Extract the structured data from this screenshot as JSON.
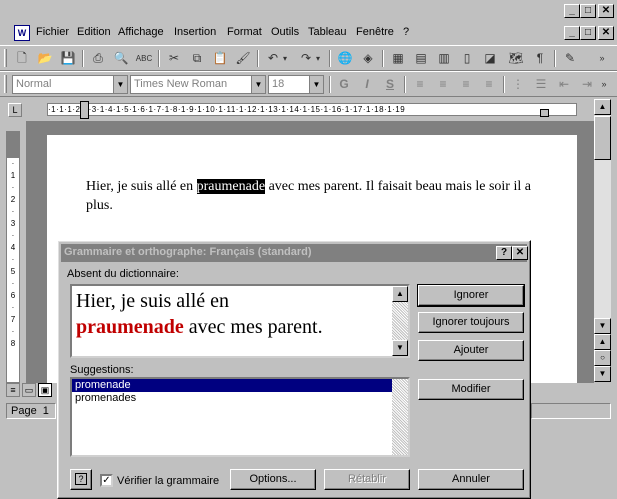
{
  "menubar": {
    "items": [
      "Fichier",
      "Edition",
      "Affichage",
      "Insertion",
      "Format",
      "Outils",
      "Tableau",
      "Fenêtre",
      "?"
    ]
  },
  "formatting": {
    "style": "Normal",
    "font": "Times New Roman",
    "size": "18",
    "bold": "G",
    "italic": "I",
    "underline": "S"
  },
  "ruler": {
    "marks": "·1·1·1·2·1·3·1·4·1·5·1·6·1·7·1·8·1·9·1·10·1·11·1·12·1·13·1·14·1·15·1·16·1·17·1·18·1·19"
  },
  "document": {
    "before": "Hier, je suis allé en ",
    "highlighted": "praumenade",
    "after": " avec mes parent. Il faisait beau mais le soir il a plus."
  },
  "statusbar": {
    "page": "Page  1"
  },
  "dialog": {
    "title": "Grammaire et orthographe: Français (standard)",
    "help_btn": "?",
    "close_btn": "✕",
    "notfound_label": "Absent du dictionnaire:",
    "sentence_before": "Hier, je suis allé en",
    "error_word": "praumenade",
    "sentence_after": " avec mes parent.",
    "suggestions_label": "Suggestions:",
    "suggestions": [
      "promenade",
      "promenades"
    ],
    "ignore": "Ignorer",
    "ignore_all": "Ignorer toujours",
    "add": "Ajouter",
    "change": "Modifier",
    "check_grammar": "Vérifier la grammaire",
    "options": "Options...",
    "undo": "Rétablir",
    "cancel": "Annuler"
  }
}
